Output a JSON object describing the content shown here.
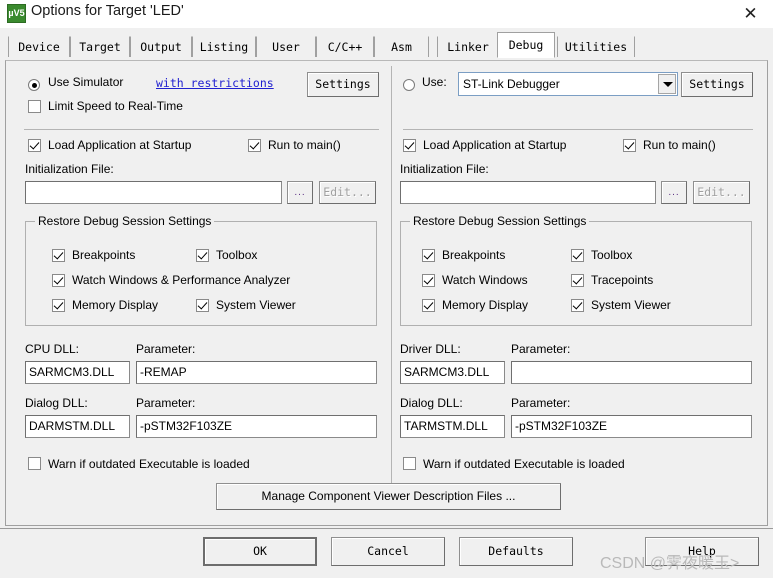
{
  "window": {
    "title": "Options for Target 'LED'",
    "icon": "uvision5-icon",
    "icon_label": "µV5",
    "close_label": "✕"
  },
  "tabs": [
    {
      "label": "Device",
      "active": false
    },
    {
      "label": "Target",
      "active": false
    },
    {
      "label": "Output",
      "active": false
    },
    {
      "label": "Listing",
      "active": false
    },
    {
      "label": "User",
      "active": false
    },
    {
      "label": "C/C++",
      "active": false
    },
    {
      "label": "Asm",
      "active": false
    },
    {
      "label": "Linker",
      "active": false
    },
    {
      "label": "Debug",
      "active": true
    },
    {
      "label": "Utilities",
      "active": false
    }
  ],
  "left": {
    "radio_label": "Use Simulator",
    "radio_selected": true,
    "restrictions_link": "with restrictions",
    "settings_button": "Settings",
    "limit_speed_label": "Limit Speed to Real-Time",
    "limit_speed_checked": false,
    "load_app_label": "Load Application at Startup",
    "load_app_checked": true,
    "run_to_main_label": "Run to main()",
    "run_to_main_checked": true,
    "init_file_label": "Initialization File:",
    "init_file_value": "",
    "browse_button": "...",
    "edit_button": "Edit...",
    "edit_disabled": true,
    "group_title": "Restore Debug Session Settings",
    "group_items": [
      {
        "label": "Breakpoints",
        "checked": true
      },
      {
        "label": "Toolbox",
        "checked": true
      },
      {
        "label": "Watch Windows & Performance Analyzer",
        "checked": true
      },
      {
        "label": "Memory Display",
        "checked": true
      },
      {
        "label": "System Viewer",
        "checked": true
      }
    ],
    "cpu_dll_label": "CPU DLL:",
    "cpu_dll_value": "SARMCM3.DLL",
    "cpu_param_label": "Parameter:",
    "cpu_param_value": "-REMAP",
    "dialog_dll_label": "Dialog DLL:",
    "dialog_dll_value": "DARMSTM.DLL",
    "dialog_param_label": "Parameter:",
    "dialog_param_value": "-pSTM32F103ZE",
    "warn_label": "Warn if outdated Executable is loaded",
    "warn_checked": false
  },
  "right": {
    "radio_label": "Use:",
    "radio_selected": false,
    "debugger_value": "ST-Link Debugger",
    "settings_button": "Settings",
    "load_app_label": "Load Application at Startup",
    "load_app_checked": true,
    "run_to_main_label": "Run to main()",
    "run_to_main_checked": true,
    "init_file_label": "Initialization File:",
    "init_file_value": "",
    "browse_button": "...",
    "edit_button": "Edit...",
    "edit_disabled": true,
    "group_title": "Restore Debug Session Settings",
    "group_items": [
      {
        "label": "Breakpoints",
        "checked": true
      },
      {
        "label": "Toolbox",
        "checked": true
      },
      {
        "label": "Watch Windows",
        "checked": true
      },
      {
        "label": "Tracepoints",
        "checked": true
      },
      {
        "label": "Memory Display",
        "checked": true
      },
      {
        "label": "System Viewer",
        "checked": true
      }
    ],
    "driver_dll_label": "Driver DLL:",
    "driver_dll_value": "SARMCM3.DLL",
    "driver_param_label": "Parameter:",
    "driver_param_value": "",
    "dialog_dll_label": "Dialog DLL:",
    "dialog_dll_value": "TARMSTM.DLL",
    "dialog_param_label": "Parameter:",
    "dialog_param_value": "-pSTM32F103ZE",
    "warn_label": "Warn if outdated Executable is loaded",
    "warn_checked": false
  },
  "manage_button": "Manage Component Viewer Description Files ...",
  "footer": {
    "ok": "OK",
    "cancel": "Cancel",
    "defaults": "Defaults",
    "help": "Help"
  },
  "watermark": "CSDN @霁夜暖玉>",
  "colors": {
    "dialog_bg": "#f0f0f0",
    "link": "#2020d0",
    "icon_green": "#3a8a2e",
    "watermark": "#b9b9b9"
  }
}
